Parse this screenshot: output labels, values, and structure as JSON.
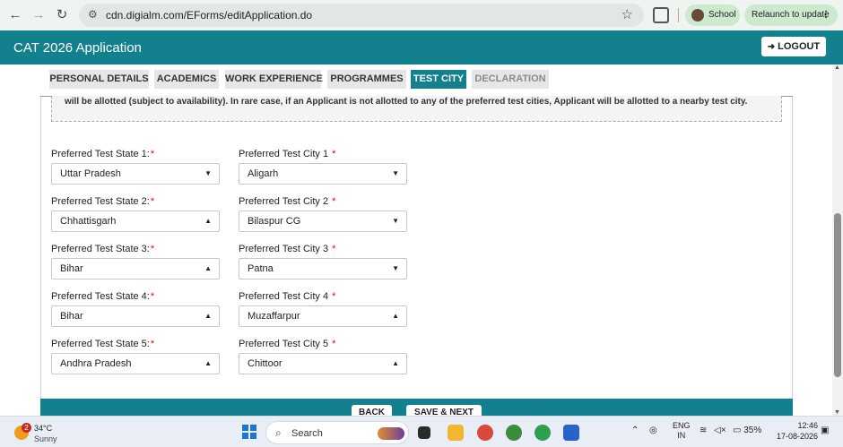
{
  "browser": {
    "url": "cdn.digialm.com/EForms/editApplication.do",
    "profile_label": "School",
    "relaunch_label": "Relaunch to update"
  },
  "app": {
    "title": "CAT 2026 Application",
    "logout_label": "LOGOUT"
  },
  "tabs": [
    {
      "label": "PERSONAL DETAILS",
      "state": "normal"
    },
    {
      "label": "ACADEMICS",
      "state": "normal"
    },
    {
      "label": "WORK EXPERIENCE",
      "state": "normal"
    },
    {
      "label": "PROGRAMMES",
      "state": "normal"
    },
    {
      "label": "TEST CITY",
      "state": "active"
    },
    {
      "label": "DECLARATION",
      "state": "disabled"
    }
  ],
  "notice_text": "will be allotted (subject to availability). In rare case, if an Applicant is not allotted to any of the preferred test cities, Applicant will be allotted to a nearby test city.",
  "preferences": [
    {
      "state_label": "Preferred Test State 1:",
      "state_value": "Uttar Pradesh",
      "state_caret": "▼",
      "city_label": "Preferred Test City 1",
      "city_value": "Aligarh",
      "city_caret": "▼"
    },
    {
      "state_label": "Preferred Test State 2:",
      "state_value": "Chhattisgarh",
      "state_caret": "▲",
      "city_label": "Preferred Test City 2",
      "city_value": "Bilaspur CG",
      "city_caret": "▼"
    },
    {
      "state_label": "Preferred Test State 3:",
      "state_value": "Bihar",
      "state_caret": "▲",
      "city_label": "Preferred Test City 3",
      "city_value": "Patna",
      "city_caret": "▼"
    },
    {
      "state_label": "Preferred Test State 4:",
      "state_value": "Bihar",
      "state_caret": "▲",
      "city_label": "Preferred Test City 4",
      "city_value": "Muzaffarpur",
      "city_caret": "▲"
    },
    {
      "state_label": "Preferred Test State 5:",
      "state_value": "Andhra Pradesh",
      "state_caret": "▲",
      "city_label": "Preferred Test City 5",
      "city_value": "Chittoor",
      "city_caret": "▲"
    }
  ],
  "required_mark": "*",
  "buttons": {
    "back": "BACK",
    "save_next": "SAVE & NEXT"
  },
  "taskbar": {
    "weather_temp": "34°C",
    "weather_condition": "Sunny",
    "weather_badge": "2",
    "search_placeholder": "Search",
    "language": "ENG",
    "region": "IN",
    "battery": "35%",
    "time": "12:46",
    "date": "17-08-2026"
  },
  "colors": {
    "brand": "#12818d",
    "required": "#e00000"
  }
}
